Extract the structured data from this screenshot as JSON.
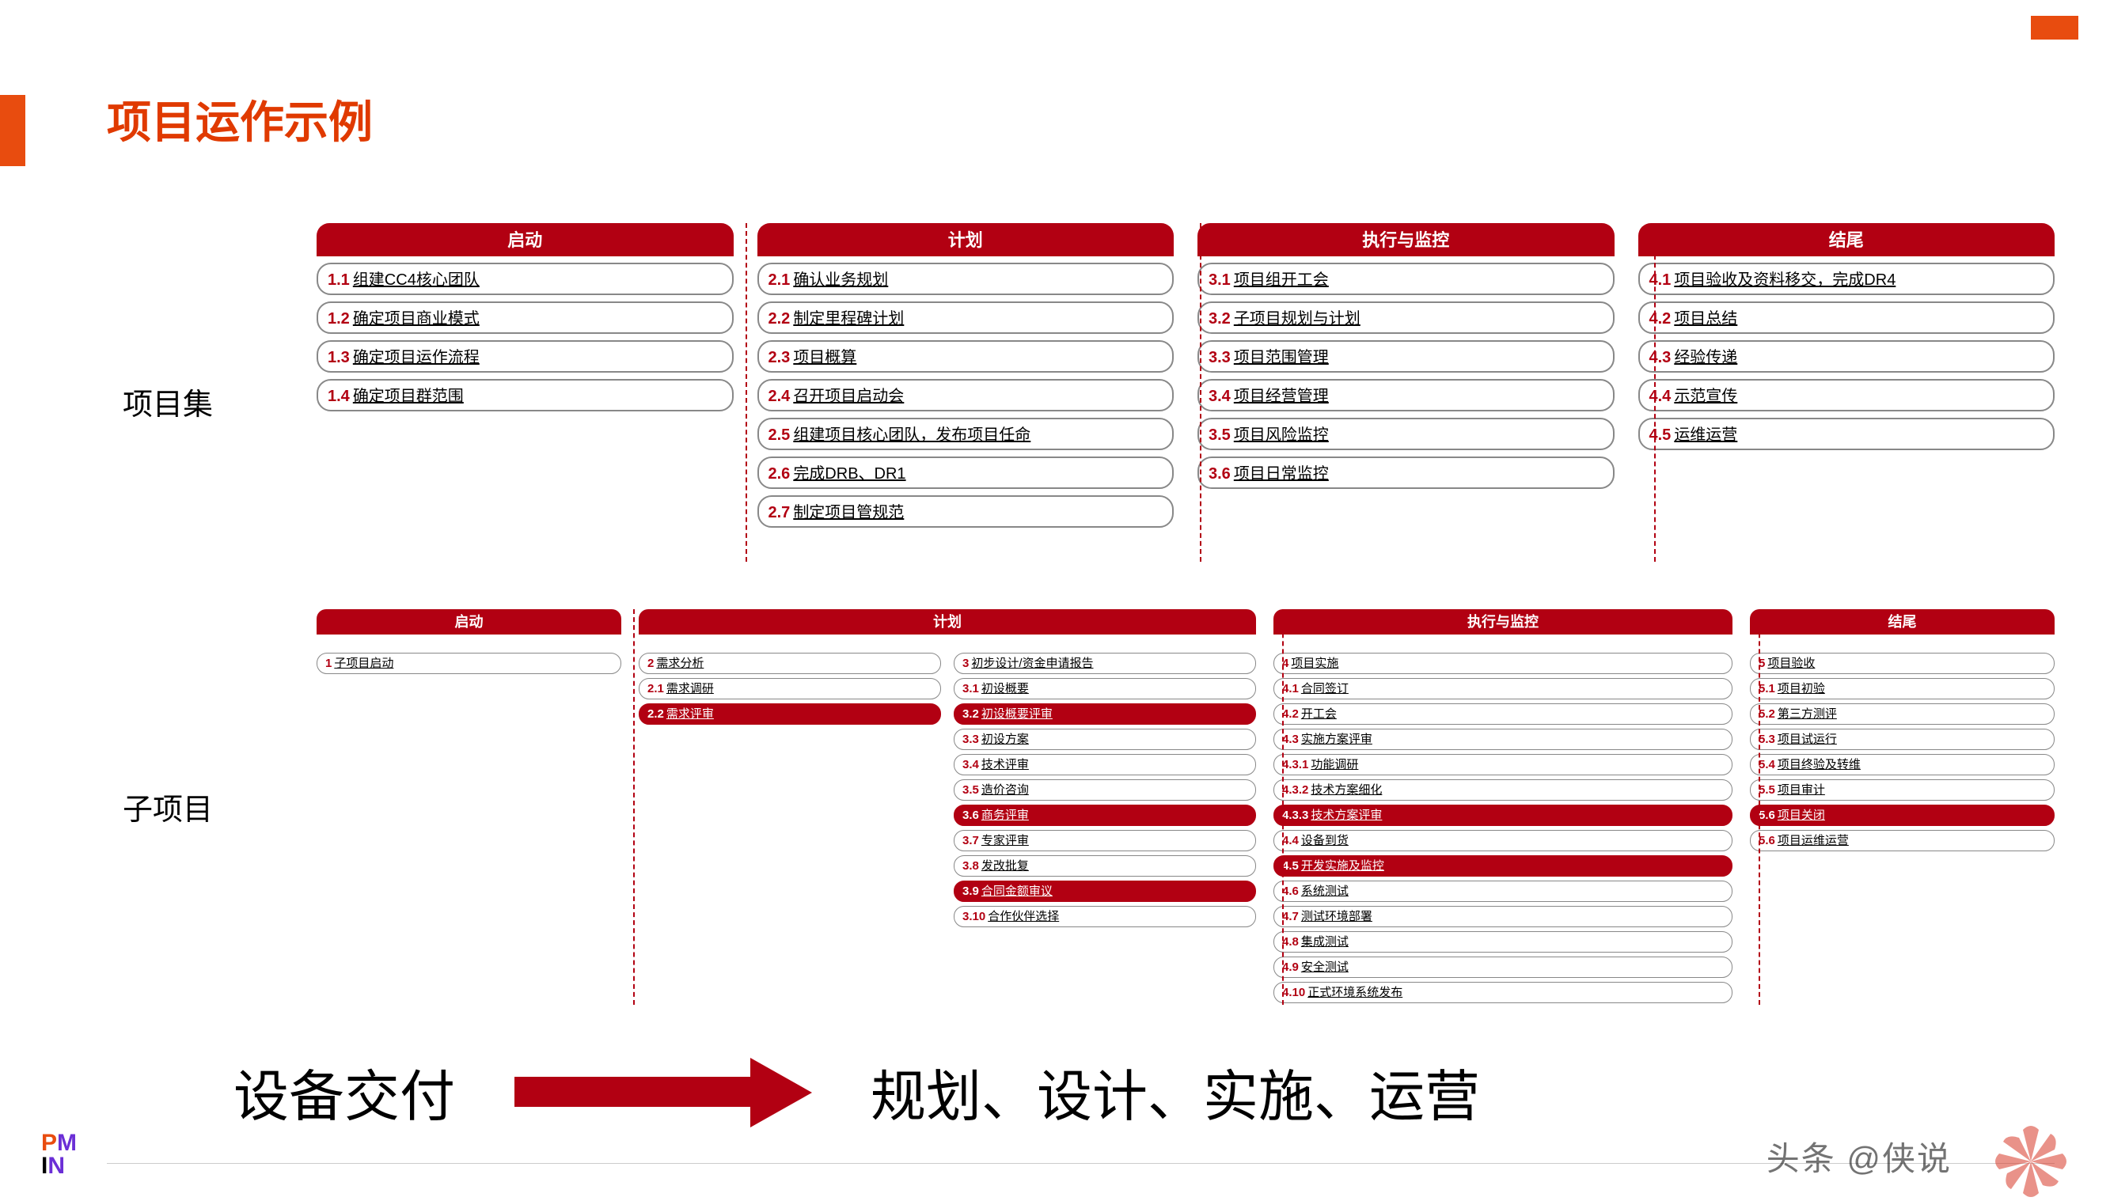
{
  "title": "项目运作示例",
  "labels": {
    "program": "项目集",
    "sub": "子项目"
  },
  "program": {
    "columns": [
      {
        "header": "启动",
        "items": [
          {
            "num": "1.1",
            "text": "组建CC4核心团队"
          },
          {
            "num": "1.2",
            "text": "确定项目商业模式"
          },
          {
            "num": "1.3",
            "text": "确定项目运作流程"
          },
          {
            "num": "1.4",
            "text": "确定项目群范围"
          }
        ]
      },
      {
        "header": "计划",
        "items": [
          {
            "num": "2.1",
            "text": "确认业务规划"
          },
          {
            "num": "2.2",
            "text": "制定里程碑计划"
          },
          {
            "num": "2.3",
            "text": "项目概算"
          },
          {
            "num": "2.4",
            "text": "召开项目启动会"
          },
          {
            "num": "2.5",
            "text": "组建项目核心团队，发布项目任命"
          },
          {
            "num": "2.6",
            "text": "完成DRB、DR1"
          },
          {
            "num": "2.7",
            "text": "制定项目管规范"
          }
        ]
      },
      {
        "header": "执行与监控",
        "items": [
          {
            "num": "3.1",
            "text": "项目组开工会"
          },
          {
            "num": "3.2",
            "text": "子项目规划与计划"
          },
          {
            "num": "3.3",
            "text": "项目范围管理"
          },
          {
            "num": "3.4",
            "text": "项目经营管理"
          },
          {
            "num": "3.5",
            "text": "项目风险监控"
          },
          {
            "num": "3.6",
            "text": "项目日常监控"
          }
        ]
      },
      {
        "header": "结尾",
        "items": [
          {
            "num": "4.1",
            "text": "项目验收及资料移交，完成DR4"
          },
          {
            "num": "4.2",
            "text": "项目总结"
          },
          {
            "num": "4.3",
            "text": "经验传递"
          },
          {
            "num": "4.4",
            "text": "示范宣传"
          },
          {
            "num": "4.5",
            "text": "运维运营"
          }
        ]
      }
    ]
  },
  "sub": {
    "columns": [
      {
        "header": "启动",
        "subcols": [
          [
            {
              "num": "1",
              "text": "子项目启动"
            }
          ]
        ]
      },
      {
        "header": "计划",
        "subcols": [
          [
            {
              "num": "2",
              "text": "需求分析"
            },
            {
              "num": "2.1",
              "text": "需求调研"
            },
            {
              "num": "2.2",
              "text": "需求评审",
              "hl": true
            }
          ],
          [
            {
              "num": "3",
              "text": "初步设计/资金申请报告"
            },
            {
              "num": "3.1",
              "text": "初设概要"
            },
            {
              "num": "3.2",
              "text": "初设概要评审",
              "hl": true
            },
            {
              "num": "3.3",
              "text": "初设方案"
            },
            {
              "num": "3.4",
              "text": "技术评审"
            },
            {
              "num": "3.5",
              "text": "造价咨询"
            },
            {
              "num": "3.6",
              "text": "商务评审",
              "hl": true
            },
            {
              "num": "3.7",
              "text": "专家评审"
            },
            {
              "num": "3.8",
              "text": "发改批复"
            },
            {
              "num": "3.9",
              "text": "合同金额审议",
              "hl": true
            },
            {
              "num": "3.10",
              "text": "合作伙伴选择"
            }
          ]
        ]
      },
      {
        "header": "执行与监控",
        "subcols": [
          [
            {
              "num": "4",
              "text": "项目实施"
            },
            {
              "num": "4.1",
              "text": "合同签订"
            },
            {
              "num": "4.2",
              "text": "开工会"
            },
            {
              "num": "4.3",
              "text": "实施方案评审"
            },
            {
              "num": "4.3.1",
              "text": "功能调研"
            },
            {
              "num": "4.3.2",
              "text": "技术方案细化"
            },
            {
              "num": "4.3.3",
              "text": "技术方案评审",
              "hl": true
            },
            {
              "num": "4.4",
              "text": "设备到货"
            },
            {
              "num": "4.5",
              "text": "开发实施及监控",
              "hl": true
            },
            {
              "num": "4.6",
              "text": "系统测试"
            },
            {
              "num": "4.7",
              "text": "测试环境部署"
            },
            {
              "num": "4.8",
              "text": "集成测试"
            },
            {
              "num": "4.9",
              "text": "安全测试"
            },
            {
              "num": "4.10",
              "text": "正式环境系统发布"
            }
          ]
        ]
      },
      {
        "header": "结尾",
        "subcols": [
          [
            {
              "num": "5",
              "text": "项目验收"
            },
            {
              "num": "5.1",
              "text": "项目初验"
            },
            {
              "num": "5.2",
              "text": "第三方测评"
            },
            {
              "num": "5.3",
              "text": "项目试运行"
            },
            {
              "num": "5.4",
              "text": "项目终验及转维"
            },
            {
              "num": "5.5",
              "text": "项目审计"
            },
            {
              "num": "5.6",
              "text": "项目关闭",
              "hl": true
            },
            {
              "num": "5.6",
              "text": "项目运维运营"
            }
          ]
        ]
      }
    ]
  },
  "bottom": {
    "left": "设备交付",
    "right": "规划、设计、实施、运营"
  },
  "watermark": "头条 @侠说"
}
